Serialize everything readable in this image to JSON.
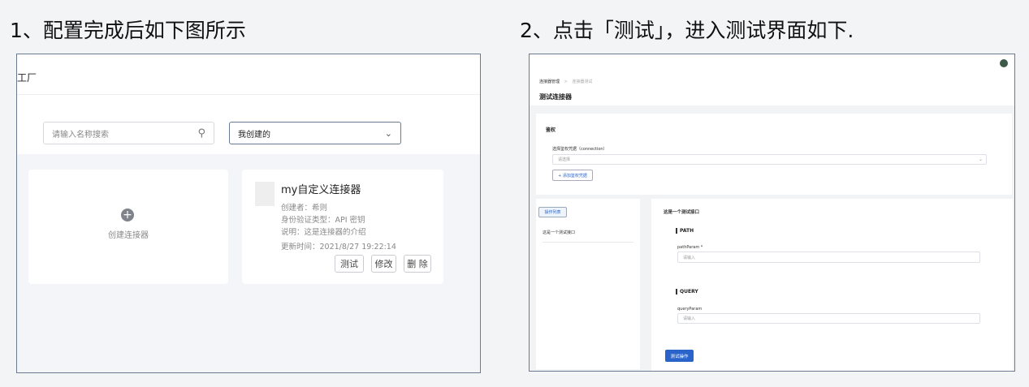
{
  "captions": {
    "step1": "1、配置完成后如下图所示",
    "step2": "2、点击「测试」，进入测试界面如下."
  },
  "left": {
    "header_title": "工厂",
    "search": {
      "placeholder": "请输入名称搜索",
      "icon": "search-icon"
    },
    "filter": {
      "value": "我创建的",
      "icon": "chevron-down-icon"
    },
    "create_card": {
      "label": "创建连接器",
      "icon": "plus-circle-icon"
    },
    "connector": {
      "name": "my自定义连接器",
      "creator": "创建者：希则",
      "auth_type": "身份验证类型：API 密钥",
      "description": "说明：这是连接器的介绍",
      "updated": "更新时间：2021/8/27 19:22:14",
      "buttons": {
        "test": "测试",
        "edit": "修改",
        "delete": "删 除"
      }
    }
  },
  "right": {
    "breadcrumb": {
      "parent": "连接器管理",
      "sep": ">",
      "current": "连接器测试"
    },
    "title": "测试连接器",
    "auth": {
      "heading": "鉴权",
      "field_label": "选择鉴权凭据（connection）",
      "placeholder": "请选择",
      "add_button": "+ 添加鉴权凭据"
    },
    "ops": {
      "list_button": "操作列表",
      "item": "这是一个测试接口"
    },
    "detail": {
      "title": "这是一个测试接口",
      "path_heading": "PATH",
      "path_label": "pathParam *",
      "path_placeholder": "请输入",
      "query_heading": "QUERY",
      "query_label": "queryParam",
      "query_placeholder": "请输入",
      "submit": "测试操作"
    }
  },
  "colors": {
    "primary": "#2a63c9",
    "border": "#6b7a90"
  }
}
